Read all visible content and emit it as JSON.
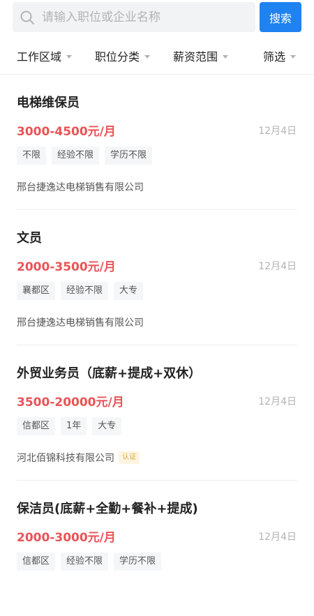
{
  "search": {
    "placeholder": "请输入职位或企业名称",
    "button_label": "搜索"
  },
  "filters": [
    {
      "label": "工作区域"
    },
    {
      "label": "职位分类"
    },
    {
      "label": "薪资范围"
    },
    {
      "label": "筛选"
    }
  ],
  "jobs": [
    {
      "title": "电梯维保员",
      "salary": "3000-4500元/月",
      "date": "12月4日",
      "tags": [
        "不限",
        "经验不限",
        "学历不限"
      ],
      "company": "邢台捷逸达电梯销售有限公司",
      "badge": ""
    },
    {
      "title": "文员",
      "salary": "2000-3500元/月",
      "date": "12月4日",
      "tags": [
        "襄都区",
        "经验不限",
        "大专"
      ],
      "company": "邢台捷逸达电梯销售有限公司",
      "badge": ""
    },
    {
      "title": "外贸业务员（底薪+提成+双休）",
      "salary": "3500-20000元/月",
      "date": "12月4日",
      "tags": [
        "信都区",
        "1年",
        "大专"
      ],
      "company": "河北佰锦科技有限公司",
      "badge": "认证"
    },
    {
      "title": "保洁员(底薪+全勤+餐补+提成)",
      "salary": "2000-3000元/月",
      "date": "12月4日",
      "tags": [
        "信都区",
        "经验不限",
        "学历不限"
      ],
      "company": "",
      "badge": ""
    }
  ],
  "colors": {
    "accent": "#1e82f0",
    "salary": "#e95356",
    "badge_text": "#e0a93a"
  }
}
